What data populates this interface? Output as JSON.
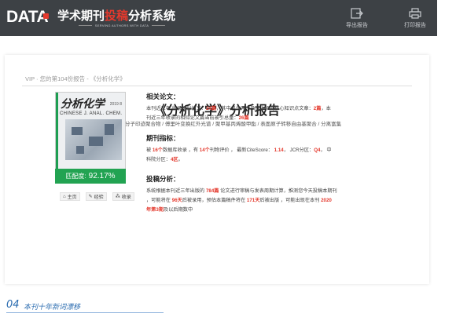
{
  "header": {
    "logo_text": "DATA",
    "title_pre": "学术期刊",
    "title_hl": "投稿",
    "title_post": "分析系统",
    "subtitle": "SERVING AUTHORS WITH DATA",
    "export_label": "导出报告",
    "print_label": "打印报告"
  },
  "report": {
    "breadcrumb": "VIP · 您的第104份报告 - 《分析化学》",
    "title": "《分析化学》分析报告",
    "knowledge_points": "核心知识点：分子印迹聚合物 / 傅里叶变换红外光谱 / 聚甲基丙烯酸甲酯 / 表面原子转移自由基聚合 / 分离富集"
  },
  "cover": {
    "cn_title": "分析化学",
    "year": "2019  8",
    "en_title": "CHINESE J. ANAL. CHEM."
  },
  "match": {
    "label": "匹配度:",
    "value": "92.17%"
  },
  "actions": [
    {
      "label": "主页"
    },
    {
      "label": "经验"
    },
    {
      "label": "收录"
    }
  ],
  "related_papers": {
    "title": "相关论文：",
    "l1a": "本刊近三年 收录相似论文：",
    "l1b": "24篇",
    "l1c": "，其中包含两个及以上相同核心知识点文章：",
    "l1d": "2篇",
    "l1e": "，本",
    "l2a": "刊近三年收录的相似论文篇当前被引总量：",
    "l2b": "26篇"
  },
  "journal_index": {
    "title": "期刊指标：",
    "l1a": "被 ",
    "l1b": "16个",
    "l1c": "数据库收录 ，有 ",
    "l1d": "14个",
    "l1e": "刊物评价 ， 最新CiteScore： ",
    "l1f": "1.14",
    "l1g": "， JCR分区：",
    "l1h": "Q4",
    "l1i": "， 中",
    "l2a": "科院分区：",
    "l2b": "4区",
    "l2c": "。"
  },
  "submission": {
    "title": "投稿分析：",
    "l1a": "系统根据本刊近三年出版的 ",
    "l1b": "784篇",
    "l1c": " 论文进行审稿与发表周期计算，推测您今天投稿本期刊",
    "l2a": "，可能将在 ",
    "l2b": "96天",
    "l2c": "后被录用，预估本篇稿件将在 ",
    "l2d": "171天",
    "l2e": "后被出版 ，可能出现在本刊 ",
    "l2f": "2020",
    "l3a": "年第3期",
    "l3b": "及以后期数中"
  },
  "footer": {
    "number": "04",
    "text": "本刊十年新词漂移"
  },
  "colors": {
    "accent": "#e4392d",
    "green": "#22a352",
    "header_bg": "#3d4145",
    "footer_blue": "#2b6cb0"
  }
}
